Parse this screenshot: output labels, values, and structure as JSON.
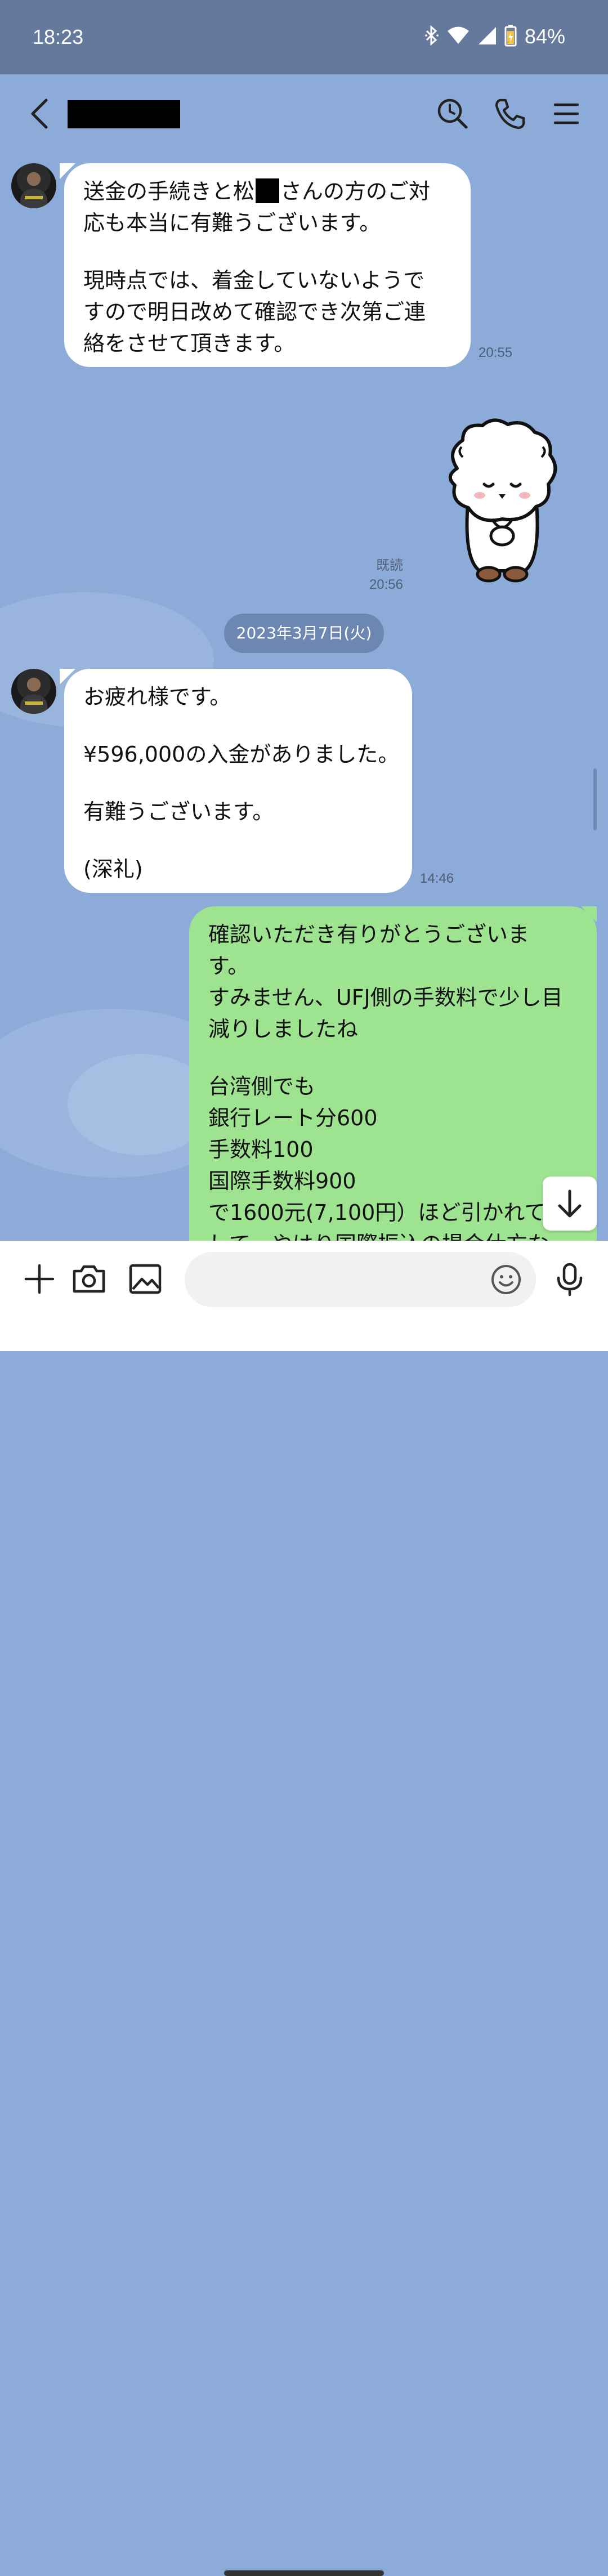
{
  "status_bar": {
    "time": "18:23",
    "battery_percent": "84%",
    "icons": [
      "bluetooth-icon",
      "wifi-icon",
      "cellular-signal-icon",
      "battery-charging-icon"
    ]
  },
  "header": {
    "contact_name": "",
    "icons": [
      "back-chevron-icon",
      "search-icon",
      "phone-icon",
      "menu-icon"
    ]
  },
  "messages": [
    {
      "direction": "incoming",
      "lines": [
        "送金の手続きと松",
        "さんの方のご対",
        "応も本当に有難うございます。",
        "",
        "現時点では、着金していないようで",
        "すので明日改めて確認でき次第ご連",
        "絡をさせて頂きます。"
      ],
      "time": "20:55"
    },
    {
      "direction": "outgoing",
      "type": "sticker",
      "sticker_icon": "bowing-sheep-sticker",
      "read_label": "既読",
      "time": "20:56"
    },
    {
      "type": "date",
      "label": "2023年3月7日(火)"
    },
    {
      "direction": "incoming",
      "lines": [
        "お疲れ様です。",
        "",
        "¥596,000の入金がありました。",
        "",
        "有難うございます。",
        "",
        "(深礼)"
      ],
      "time": "14:46"
    },
    {
      "direction": "outgoing",
      "lines": [
        "確認いただき有りがとうございま",
        "す。",
        "すみません、UFJ側の手数料で少し目",
        "減りしましたね",
        "",
        "台湾側でも",
        "銀行レート分600",
        "手数料100",
        "国際手数料900",
        "で1600元(7,100円）ほど引かれてま",
        "して、やはり国際振込の場合仕方な"
      ]
    }
  ],
  "input_bar": {
    "placeholder": "",
    "icons": [
      "plus-icon",
      "camera-icon",
      "image-icon",
      "emoji-icon",
      "microphone-icon"
    ]
  },
  "colors": {
    "status_bar": "#64799c",
    "chat_background": "#8cabd9",
    "incoming_bubble": "#ffffff",
    "outgoing_bubble": "#9de390",
    "date_pill": "#6d87b3"
  }
}
